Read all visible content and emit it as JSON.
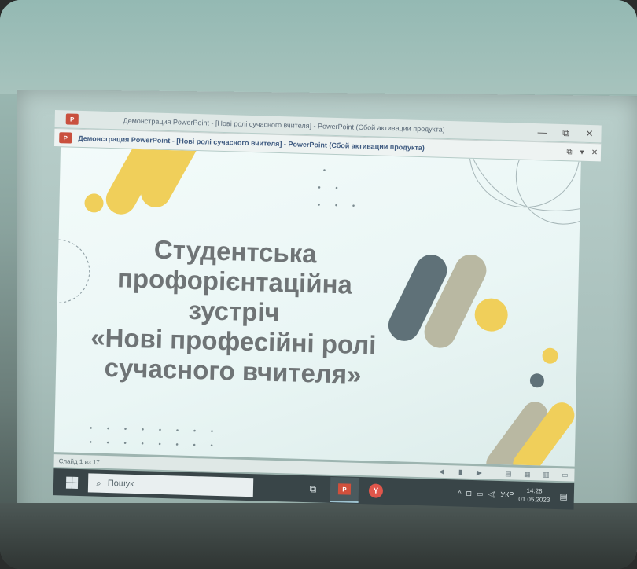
{
  "window": {
    "title_main": "Демонстрация PowerPoint - [Нові ролі сучасного вчителя] - PowerPoint (Сбой активации продукта)",
    "title_secondary": "Демонстрация PowerPoint - [Нові ролі сучасного вчителя] - PowerPoint (Сбой активации продукта)",
    "app_badge": "P",
    "controls": {
      "minimize": "—",
      "restore": "⧉",
      "close": "✕"
    }
  },
  "slide": {
    "title_lines": [
      "Студентська",
      "профорієнтаційна",
      "зустріч",
      "«Нові професійні ролі",
      "сучасного вчителя»"
    ],
    "colors": {
      "text": "#6f7476",
      "yellow": "#f0cf5a",
      "slate": "#5f7178",
      "khaki": "#b9b8a2",
      "background": "#eef8f7"
    }
  },
  "statusbar": {
    "slide_counter": "Слайд 1 из 17",
    "icons": [
      "prev-icon",
      "pause-icon",
      "next-icon",
      "normal-view-icon",
      "slide-sorter-icon",
      "reading-view-icon",
      "slideshow-icon"
    ]
  },
  "taskbar": {
    "search_placeholder": "Пошук",
    "apps": [
      "task-view-icon",
      "powerpoint-icon",
      "yandex-browser-icon"
    ],
    "tray": {
      "language": "УКР",
      "time": "14:28",
      "date": "01.05.2023"
    }
  }
}
